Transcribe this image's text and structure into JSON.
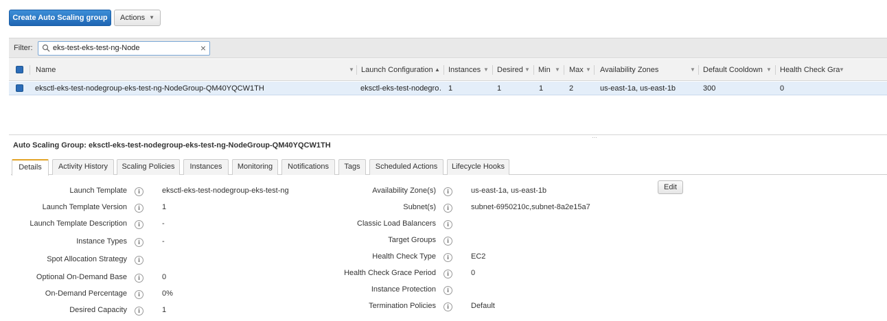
{
  "toolbar": {
    "create_label": "Create Auto Scaling group",
    "actions_label": "Actions"
  },
  "filter": {
    "label": "Filter:",
    "value": "eks-test-eks-test-ng-Node"
  },
  "table": {
    "columns": [
      "Name",
      "Launch Configuration",
      "Instances",
      "Desired",
      "Min",
      "Max",
      "Availability Zones",
      "Default Cooldown",
      "Health Check Grac"
    ],
    "rows": [
      {
        "name": "eksctl-eks-test-nodegroup-eks-test-ng-NodeGroup-QM40YQCW1TH",
        "launch_configuration": "eksctl-eks-test-nodegro…",
        "instances": "1",
        "desired": "1",
        "min": "1",
        "max": "2",
        "availability_zones": "us-east-1a, us-east-1b",
        "default_cooldown": "300",
        "health_check_grace": "0"
      }
    ]
  },
  "detail": {
    "title": "Auto Scaling Group: eksctl-eks-test-nodegroup-eks-test-ng-NodeGroup-QM40YQCW1TH",
    "tabs": [
      "Details",
      "Activity History",
      "Scaling Policies",
      "Instances",
      "Monitoring",
      "Notifications",
      "Tags",
      "Scheduled Actions",
      "Lifecycle Hooks"
    ],
    "edit_label": "Edit",
    "left": [
      {
        "label": "Launch Template",
        "value": "eksctl-eks-test-nodegroup-eks-test-ng"
      },
      {
        "label": "Launch Template Version",
        "value": "1"
      },
      {
        "label": "Launch Template Description",
        "value": "-"
      },
      {
        "label": "Instance Types",
        "value": "-"
      },
      {
        "label": "Spot Allocation Strategy",
        "value": ""
      },
      {
        "label": "Optional On-Demand Base",
        "value": "0"
      },
      {
        "label": "On-Demand Percentage",
        "value": "0%"
      },
      {
        "label": "Desired Capacity",
        "value": "1"
      }
    ],
    "right": [
      {
        "label": "Availability Zone(s)",
        "value": "us-east-1a, us-east-1b"
      },
      {
        "label": "Subnet(s)",
        "value": "subnet-6950210c,subnet-8a2e15a7"
      },
      {
        "label": "Classic Load Balancers",
        "value": ""
      },
      {
        "label": "Target Groups",
        "value": ""
      },
      {
        "label": "Health Check Type",
        "value": "EC2"
      },
      {
        "label": "Health Check Grace Period",
        "value": "0"
      },
      {
        "label": "Instance Protection",
        "value": ""
      },
      {
        "label": "Termination Policies",
        "value": "Default"
      }
    ]
  }
}
